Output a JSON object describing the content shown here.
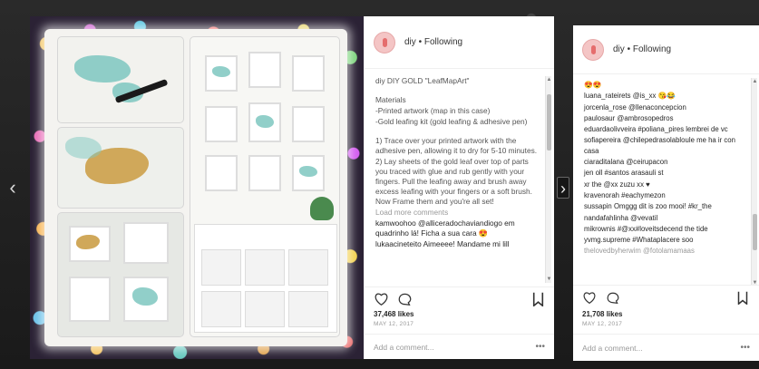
{
  "navigation": {
    "prev_label": "‹",
    "next_label": "›"
  },
  "post1": {
    "header": {
      "username": "diy",
      "separator": " • ",
      "follow_label": "Following"
    },
    "comments": [
      {
        "text": "diy DIY GOLD \"LeafMapArt\"",
        "kind": "normal"
      },
      {
        "text": "",
        "kind": "gap"
      },
      {
        "text": "Materials",
        "kind": "normal"
      },
      {
        "text": "-Printed artwork (map in this case)",
        "kind": "normal"
      },
      {
        "text": "-Gold leafing kit (gold leafing & adhesive pen)",
        "kind": "normal"
      },
      {
        "text": "",
        "kind": "gap"
      },
      {
        "text": "1) Trace over your printed artwork with the adhesive pen, allowing it to dry for 5-10 minutes.",
        "kind": "normal"
      },
      {
        "text": "2) Lay sheets of the gold leaf over top of parts you traced with glue and rub gently with your fingers. Pull the leafing away and brush away excess leafing with your fingers or a soft brush. Now Frame them and you're all set!",
        "kind": "normal"
      },
      {
        "text": "Load more comments",
        "kind": "muted"
      },
      {
        "text": "kamwoohoo @alliceradochaviandiogo em quadrinho lá! Ficha a sua cara 😍",
        "kind": "handle"
      },
      {
        "text": "lukaacineteito Aimeeee! Mandame mi lill",
        "kind": "handle"
      }
    ],
    "likes": "37,468 likes",
    "date": "MAY 12, 2017",
    "add_comment_placeholder": "Add a comment...",
    "more_label": "•••"
  },
  "post2": {
    "header": {
      "username": "diy",
      "separator": " • ",
      "follow_label": "Following"
    },
    "comments": [
      {
        "text": "😍😍",
        "kind": "normal"
      },
      {
        "text": "luana_rateirets @is_xx 😘😂",
        "kind": "handle"
      },
      {
        "text": "jorcenla_rose @llenaconcepcion",
        "kind": "handle"
      },
      {
        "text": "paulosaur @ambrosopedros",
        "kind": "handle"
      },
      {
        "text": "eduardaolivveira #poliana_pires lembrei de vc",
        "kind": "handle"
      },
      {
        "text": "sofiapereira @chilepedrasolabloule me ha ir con casa",
        "kind": "handle"
      },
      {
        "text": "ciaraditalana @ceirupacon",
        "kind": "handle"
      },
      {
        "text": "jen oll #santos arasauli st",
        "kind": "handle"
      },
      {
        "text": "xr the @xx zuzu xx ♥",
        "kind": "handle"
      },
      {
        "text": "kravenorah #eachymezon",
        "kind": "handle"
      },
      {
        "text": "sussapin Omggg dit is zoo mooi! #kr_the",
        "kind": "handle"
      },
      {
        "text": "nandafahlinha @vevatil",
        "kind": "handle"
      },
      {
        "text": "mikrownis #@xx#loveitsdecend the tide",
        "kind": "handle"
      },
      {
        "text": "yvmg.supreme #Whataplacere soo",
        "kind": "handle"
      },
      {
        "text": "thelovedbyherwim @fotolamamaas",
        "kind": "muted"
      }
    ],
    "likes": "21,708 likes",
    "date": "MAY 12, 2017",
    "add_comment_placeholder": "Add a comment...",
    "more_label": "•••"
  }
}
